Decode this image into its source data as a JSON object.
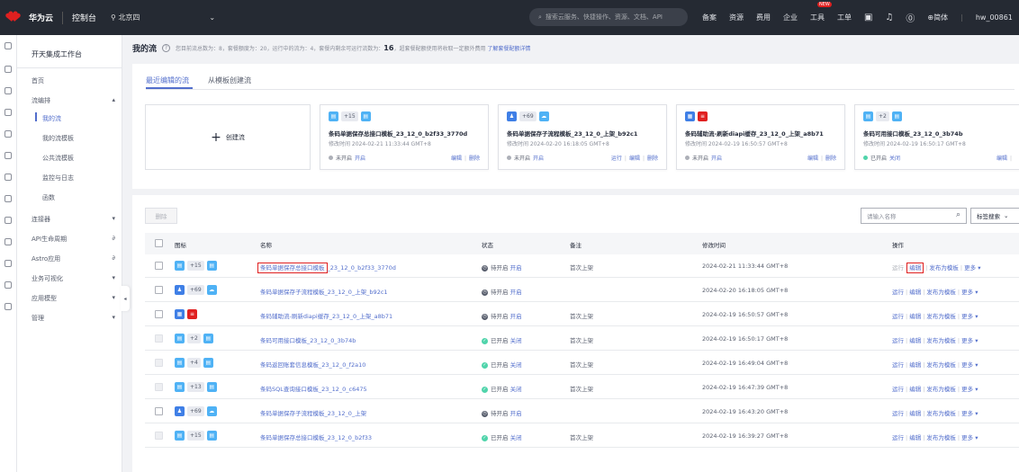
{
  "topbar": {
    "brand": "华为云",
    "console": "控制台",
    "region": "北京四",
    "search_placeholder": "搜索云服务、快捷操作、资源、文档、API",
    "nav": [
      "备案",
      "资源",
      "费用",
      "企业",
      "工具",
      "工单"
    ],
    "new_badge": "NEW",
    "lang": "简体",
    "user": "hw_00861"
  },
  "sidebar": {
    "title": "开天集成工作台",
    "items": {
      "home": "首页",
      "flow": "流编排",
      "my_flow": "我的流",
      "my_templates": "我的流模板",
      "public_templates": "公共流模板",
      "monitor": "监控与日志",
      "functions": "函数",
      "connectors": "连接器",
      "api_lifecycle": "API生命周期",
      "astro": "Astro应用",
      "biz_visual": "业务可视化",
      "app_model": "应用模型",
      "manage": "管理"
    }
  },
  "headline": {
    "title": "我的流",
    "text_a": "您目前流总数为：8，套餐额度为：20，运行中的流为：4，套餐内剩余可运行流数为：",
    "remaining": "16",
    "text_b": "，超套餐配额使用将收取一定额外费用",
    "link": "了解套餐配额详情"
  },
  "tabs": {
    "recent": "最近编辑的流",
    "from_template": "从模板创建流"
  },
  "create_card": {
    "label": "创建流"
  },
  "cards": [
    {
      "pill": "+15",
      "title": "条码单据保存总接口模板_23_12_0_b2f33_3770d",
      "time": "修改时间  2024-02-21 11:33:44 GMT+8",
      "status": "未开启",
      "toggle": "开启",
      "ops": [
        "编辑",
        "删除"
      ]
    },
    {
      "pill": "+69",
      "title": "条码单据保存子流程模板_23_12_0_上架_b92c1",
      "time": "修改时间  2024-02-20 16:18:05 GMT+8",
      "status": "未开启",
      "toggle": "开启",
      "ops": [
        "运行",
        "编辑",
        "删除"
      ]
    },
    {
      "pill": "",
      "title": "条码辅助流-刷新diapi缓存_23_12_0_上架_a8b71",
      "time": "修改时间  2024-02-19 16:50:57 GMT+8",
      "status": "未开启",
      "toggle": "开启",
      "ops": [
        "编辑",
        "删除"
      ]
    },
    {
      "pill": "+2",
      "title": "条码可用接口模板_23_12_0_3b74b",
      "time": "修改时间  2024-02-19 16:50:17 GMT+8",
      "status": "已开启",
      "toggle": "关闭",
      "ops": [
        "编辑"
      ]
    }
  ],
  "toolbar": {
    "delete": "删除",
    "name_placeholder": "请输入名称",
    "tag_search": "标签搜索"
  },
  "table": {
    "headers": {
      "icon": "图标",
      "name": "名称",
      "status": "状态",
      "remark": "备注",
      "modified": "修改时间",
      "ops": "操作"
    },
    "op_labels": {
      "run": "运行",
      "edit": "编辑",
      "publish": "发布为模板",
      "more": "更多"
    },
    "rows": [
      {
        "pill": "+15",
        "name_hl": "条码单据保存总接口模板",
        "name_rest": "_23_12_0_b2f33_3770d",
        "status": "待开启",
        "toggle": "开启",
        "remark": "首次上架",
        "modified": "2024-02-21 11:33:44 GMT+8"
      },
      {
        "pill": "+69",
        "name_hl": "",
        "name_rest": "条码单据保存子流程模板_23_12_0_上架_b92c1",
        "status": "待开启",
        "toggle": "开启",
        "remark": "",
        "modified": "2024-02-20 16:18:05 GMT+8"
      },
      {
        "pill": "",
        "name_hl": "",
        "name_rest": "条码辅助流-刷新diapi缓存_23_12_0_上架_a8b71",
        "status": "待开启",
        "toggle": "开启",
        "remark": "首次上架",
        "modified": "2024-02-19 16:50:57 GMT+8"
      },
      {
        "pill": "+2",
        "name_hl": "",
        "name_rest": "条码可用接口模板_23_12_0_3b74b",
        "status": "已开启",
        "toggle": "关闭",
        "remark": "首次上架",
        "modified": "2024-02-19 16:50:17 GMT+8"
      },
      {
        "pill": "+4",
        "name_hl": "",
        "name_rest": "条码返回账套信息模板_23_12_0_f2a10",
        "status": "已开启",
        "toggle": "关闭",
        "remark": "首次上架",
        "modified": "2024-02-19 16:49:04 GMT+8"
      },
      {
        "pill": "+13",
        "name_hl": "",
        "name_rest": "条码SQL查询接口模板_23_12_0_c6475",
        "status": "已开启",
        "toggle": "关闭",
        "remark": "首次上架",
        "modified": "2024-02-19 16:47:39 GMT+8"
      },
      {
        "pill": "+69",
        "name_hl": "",
        "name_rest": "条码单据保存子流程模板_23_12_0_上架",
        "status": "待开启",
        "toggle": "开启",
        "remark": "",
        "modified": "2024-02-19 16:43:20 GMT+8"
      },
      {
        "pill": "+15",
        "name_hl": "",
        "name_rest": "条码单据保存总接口模板_23_12_0_b2f33",
        "status": "已开启",
        "toggle": "关闭",
        "remark": "首次上架",
        "modified": "2024-02-19 16:39:27 GMT+8"
      }
    ]
  }
}
